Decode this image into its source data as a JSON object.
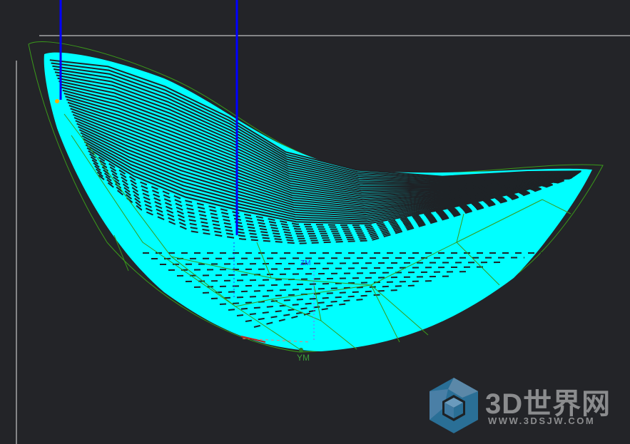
{
  "viewport": {
    "axis_labels": {
      "ym": "YM",
      "zm": "ZM"
    },
    "colors": {
      "background": "#232428",
      "surface": "#00ffff",
      "toolpath": "#1e2226",
      "wireframe": "#3a9a1a",
      "tool_axis": "#0000ff",
      "crosshair": "#e0e0e0"
    }
  },
  "watermark": {
    "title": "3D世界网",
    "url": "WWW.3DSJW.COM"
  }
}
